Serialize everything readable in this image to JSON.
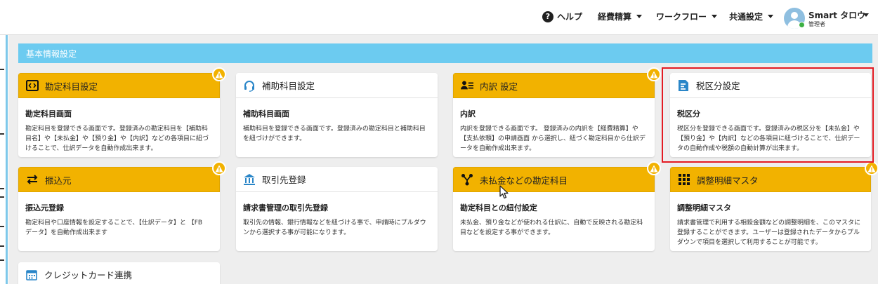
{
  "header": {
    "help_label": "ヘルプ",
    "menus": [
      "経費精算",
      "ワークフロー",
      "共通設定"
    ],
    "user_name": "Smart タロウ",
    "user_role": "管理者"
  },
  "section": {
    "title": "基本情報設定"
  },
  "cards": [
    {
      "title": "勘定科目設定",
      "icon": "code-icon",
      "style": "yellow",
      "warning": true,
      "subtitle": "勘定科目画面",
      "desc": [
        "勘定科目を登録できる画面です。登録済みの勘定科目を【補助科",
        "目名】や【未払金】や【預り金】や【内訳】などの各項目に紐づ",
        "けることで、仕訳データを自動作成出来ます。"
      ]
    },
    {
      "title": "補助科目設定",
      "icon": "headset-icon",
      "style": "white",
      "warning": false,
      "subtitle": "補助科目画面",
      "desc": [
        "補助科目を登録できる画面です。登録済みの勘定科目と補助科目",
        "を紐づけができます。"
      ]
    },
    {
      "title": "内訳 設定",
      "icon": "user-list-icon",
      "style": "yellow",
      "warning": true,
      "subtitle": "内訳",
      "desc": [
        "内訳を登録できる画面です。 登録済みの内訳を【経費精算】や",
        "【支払依頼】の申請画面 から選択し、紐づく勘定科目から仕訳デ",
        "ータを自動作成出来ます。"
      ]
    },
    {
      "title": "税区分設定",
      "icon": "document-icon",
      "style": "white",
      "warning": false,
      "subtitle": "税区分",
      "desc": [
        "税区分を登録できる画面です。登録済みの税区分を【未払金】や",
        "【預り金】や【内訳】などの各項目に紐づけることで、仕訳デー",
        "タの自動作成や税額の自動計算が出来ます。"
      ]
    },
    {
      "title": "振込元",
      "icon": "transfer-arrows-icon",
      "style": "yellow",
      "warning": true,
      "subtitle": "振込元登録",
      "desc": [
        "勘定科目や口座情報を設定することで、【仕訳データ】と 【FB",
        "データ】を自動作成出来ます"
      ]
    },
    {
      "title": "取引先登録",
      "icon": "bank-icon",
      "style": "white",
      "warning": false,
      "subtitle": "請求書管理の取引先登録",
      "desc": [
        "取引先の情報、銀行情報などを紐づける事で、申請時にプルダウ",
        "ンから選択する事が可能になります。"
      ]
    },
    {
      "title": "未払金などの勘定科目",
      "icon": "network-icon",
      "style": "yellow",
      "warning": true,
      "subtitle": "勘定科目との紐付設定",
      "desc": [
        "未払金、預り金などが使われる仕訳に、自動で反映される勘定科",
        "目などを設定する事ができます。"
      ]
    },
    {
      "title": "調整明細マスタ",
      "icon": "grid-icon",
      "style": "yellow",
      "warning": true,
      "subtitle": "調整明細マスタ",
      "desc": [
        "請求書管理で利用する相殺金額などの調整明細を、このマスタに",
        "登録することができます。ユーザーは登録されたデータからプル",
        "ダウンで項目を選択して利用することが可能です。"
      ]
    },
    {
      "title": "クレジットカード連携",
      "icon": "calendar-icon",
      "style": "white",
      "warning": false,
      "subtitle": "",
      "desc": []
    }
  ]
}
